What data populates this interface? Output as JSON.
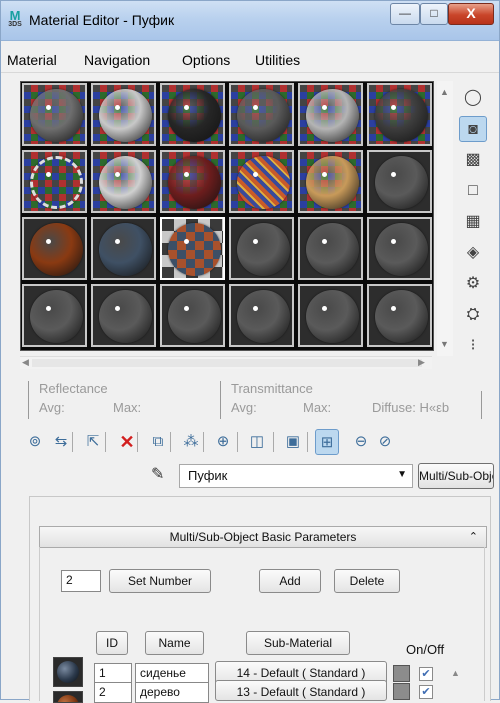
{
  "window": {
    "title": "Material Editor - Пуфик",
    "app_icon": "3ds-max-icon",
    "controls": {
      "minimize": "—",
      "maximize": "□",
      "close": "X"
    }
  },
  "menubar": [
    "Material",
    "Navigation",
    "Options",
    "Utilities"
  ],
  "slots": {
    "rows": 4,
    "cols": 6,
    "items": [
      {
        "kind": "checker-sphere",
        "color": "#6e6e6e"
      },
      {
        "kind": "checker-sphere",
        "color": "#c8c8c8"
      },
      {
        "kind": "checker-sphere",
        "color": "#262626"
      },
      {
        "kind": "checker-sphere",
        "color": "#5a5a5a"
      },
      {
        "kind": "checker-sphere",
        "color": "#b4b4b4"
      },
      {
        "kind": "checker-sphere",
        "color": "#3c3c3c"
      },
      {
        "kind": "checker-ring",
        "color": "#151515"
      },
      {
        "kind": "checker-sphere",
        "color": "#d0d0d0"
      },
      {
        "kind": "checker-sphere",
        "color": "#6d1d1d"
      },
      {
        "kind": "checker-pattern",
        "color": "#3a3a60"
      },
      {
        "kind": "checker-sphere",
        "color": "#c89a5a"
      },
      {
        "kind": "plain-sphere",
        "color": "#5a5a5a"
      },
      {
        "kind": "plain-sphere",
        "color": "#8a3a12"
      },
      {
        "kind": "plain-sphere",
        "color": "#3f5064"
      },
      {
        "kind": "checker-bg-sphere",
        "color": "#5c4038"
      },
      {
        "kind": "plain-sphere",
        "color": "#5a5a5a"
      },
      {
        "kind": "plain-sphere",
        "color": "#5a5a5a"
      },
      {
        "kind": "plain-sphere",
        "color": "#5a5a5a"
      },
      {
        "kind": "plain-sphere",
        "color": "#5a5a5a"
      },
      {
        "kind": "plain-sphere",
        "color": "#5a5a5a"
      },
      {
        "kind": "plain-sphere",
        "color": "#5a5a5a"
      },
      {
        "kind": "plain-sphere",
        "color": "#5a5a5a"
      },
      {
        "kind": "plain-sphere",
        "color": "#5a5a5a"
      },
      {
        "kind": "plain-sphere",
        "color": "#5a5a5a"
      }
    ]
  },
  "side_toolbar": [
    {
      "icon": "sample-type-sphere-icon",
      "glyph": "◯"
    },
    {
      "icon": "backlight-icon",
      "glyph": "◙"
    },
    {
      "icon": "background-checker-icon",
      "glyph": "▩"
    },
    {
      "icon": "uv-tiling-icon",
      "glyph": "□"
    },
    {
      "icon": "video-color-check-icon",
      "glyph": "▦"
    },
    {
      "icon": "make-preview-icon",
      "glyph": "◈"
    },
    {
      "icon": "options-icon",
      "glyph": "⚙"
    },
    {
      "icon": "select-by-material-icon",
      "glyph": "⛭"
    },
    {
      "icon": "material-navigator-icon",
      "glyph": "⁝"
    }
  ],
  "info": {
    "reflectance": "Reflectance",
    "transmittance": "Transmittance",
    "avg": "Avg:",
    "max": "Max:",
    "diffuse": "Diffuse: H«εb"
  },
  "bottom_toolbar": [
    {
      "icon": "get-material-icon",
      "glyph": "⊚"
    },
    {
      "icon": "put-material-to-scene-icon",
      "glyph": "⇆"
    },
    {
      "icon": "assign-material-icon",
      "glyph": "⇱"
    },
    {
      "icon": "reset-map-icon",
      "glyph": "✕"
    },
    {
      "icon": "make-copy-icon",
      "glyph": "⧉"
    },
    {
      "icon": "make-unique-icon",
      "glyph": "⁂"
    },
    {
      "icon": "put-to-library-icon",
      "glyph": "⊕"
    },
    {
      "icon": "material-id-channel-icon",
      "glyph": "◫"
    },
    {
      "icon": "show-map-in-viewport-icon",
      "glyph": "▣"
    },
    {
      "icon": "show-end-result-icon",
      "glyph": "⊞"
    },
    {
      "icon": "go-to-parent-icon",
      "glyph": "⊖"
    },
    {
      "icon": "go-forward-to-sibling-icon",
      "glyph": "⊘"
    }
  ],
  "material": {
    "name": "Пуфик",
    "type": "Multi/Sub-Object"
  },
  "rollout": {
    "title": "Multi/Sub-Object Basic Parameters",
    "count": "2",
    "set_number": "Set Number",
    "add": "Add",
    "delete": "Delete",
    "headers": {
      "id": "ID",
      "name": "Name",
      "sub_material": "Sub-Material",
      "on_off": "On/Off"
    },
    "rows": [
      {
        "id": "1",
        "name": "сиденье",
        "sub_material": "14 - Default  ( Standard )",
        "swatch": "#2c3a4c",
        "on": "✔"
      },
      {
        "id": "2",
        "name": "дерево",
        "sub_material": "13 - Default  ( Standard )",
        "swatch": "#7a3510",
        "on": "✔"
      }
    ]
  }
}
